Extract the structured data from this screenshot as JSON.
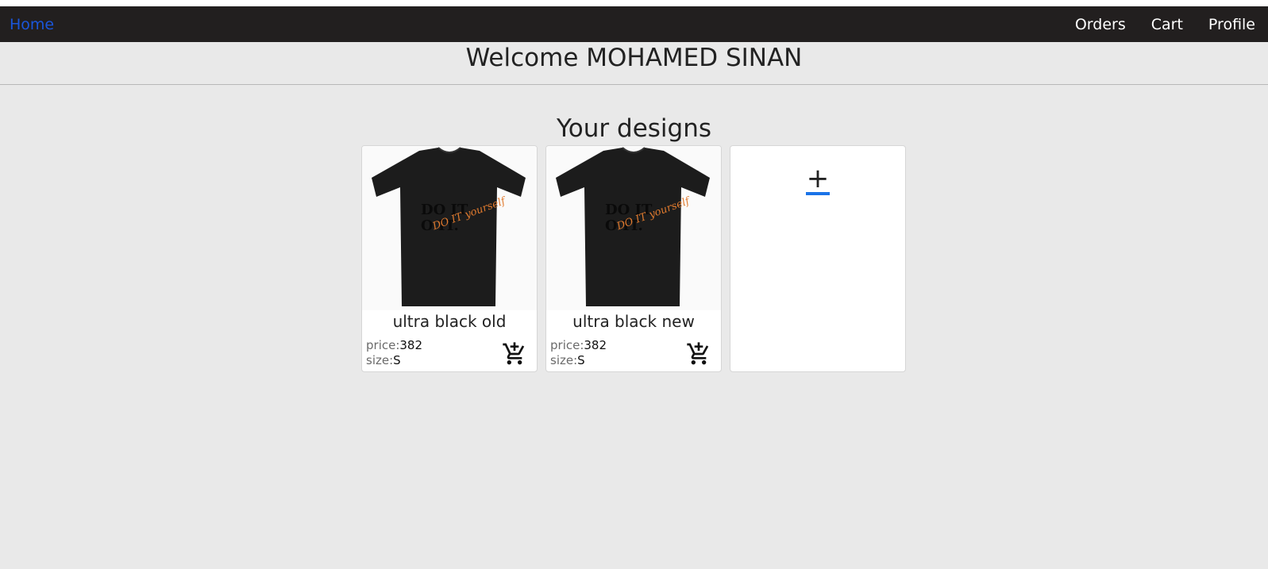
{
  "nav": {
    "home": "Home",
    "links": [
      "Orders",
      "Cart",
      "Profile"
    ]
  },
  "welcome": "Welcome MOHAMED SINAN",
  "section_title": "Your designs",
  "designs": [
    {
      "name": "ultra black old",
      "price_label": "price:",
      "price": "382",
      "size_label": "size:",
      "size": "S",
      "print_text": "DO IT yourself"
    },
    {
      "name": "ultra black new",
      "price_label": "price:",
      "price": "382",
      "size_label": "size:",
      "size": "S",
      "print_text": "DO IT yourself"
    }
  ],
  "add_design": {
    "symbol": "+"
  },
  "colors": {
    "navbar": "#221f1f",
    "home_link": "#1a56db",
    "accent": "#1a73e8",
    "background": "#e9e9e9"
  }
}
